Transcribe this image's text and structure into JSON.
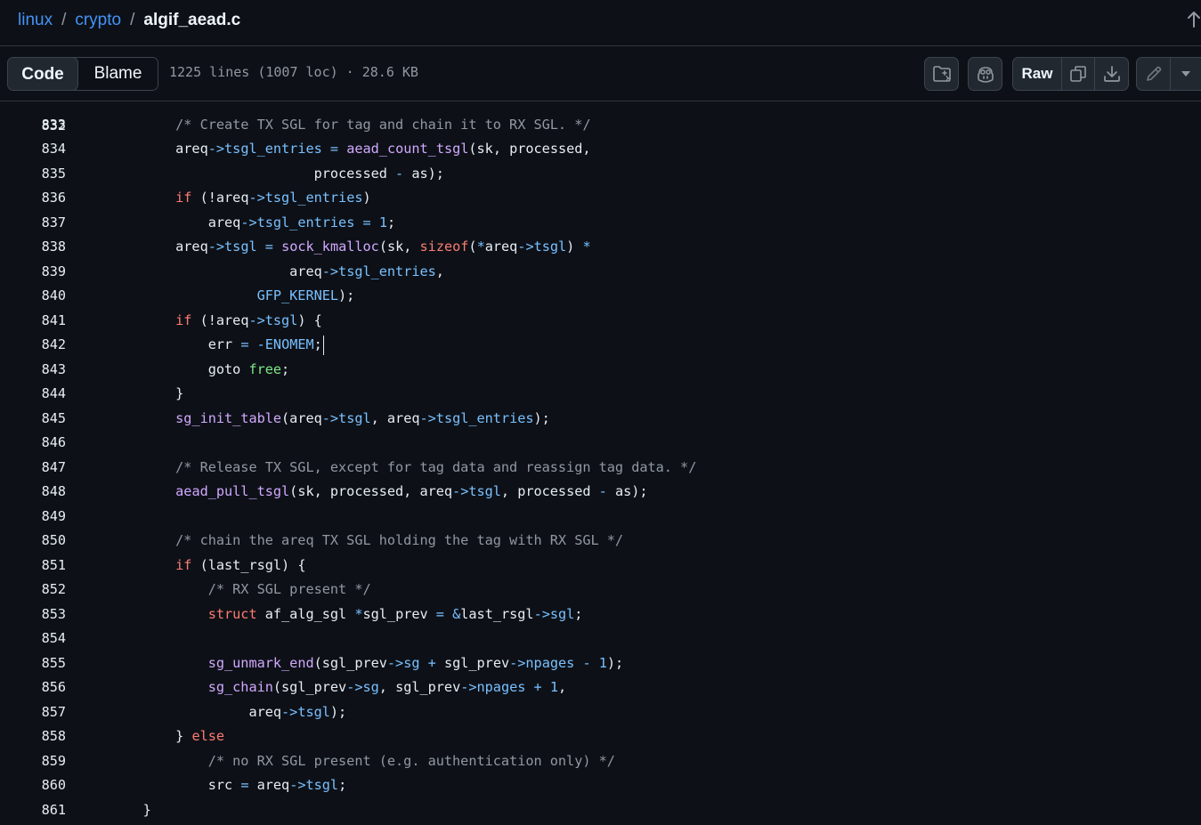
{
  "breadcrumb": {
    "repo": "linux",
    "folder": "crypto",
    "file": "algif_aead.c",
    "separator": "/"
  },
  "toolbar": {
    "code_tab": "Code",
    "blame_tab": "Blame",
    "file_info": "1225 lines (1007 loc) · 28.6 KB",
    "raw_label": "Raw"
  },
  "icons": {
    "scroll_top": "arrow-up-icon",
    "symbols": "file-directory-symlink-icon",
    "copilot": "copilot-icon",
    "copy": "copy-icon",
    "download": "download-icon",
    "edit": "pencil-icon",
    "more": "triangle-down-icon"
  },
  "colors": {
    "background": "#0d1117",
    "text": "#e6edf3",
    "link": "#4493f8",
    "comment": "#9198a1",
    "function": "#d2a8ff",
    "keyword": "#ff7b72",
    "property": "#79c0ff",
    "label": "#7ee787"
  },
  "code": {
    "partial_top_line": "832",
    "lines": [
      {
        "n": "833",
        "tokens": [
          [
            "        ",
            ""
          ],
          [
            "/* Create TX SGL for tag and chain it to RX SGL. */",
            "c"
          ]
        ]
      },
      {
        "n": "834",
        "tokens": [
          [
            "        areq",
            ""
          ],
          [
            "->",
            "o"
          ],
          [
            "tsgl_entries",
            "p"
          ],
          [
            " ",
            ""
          ],
          [
            "=",
            "o"
          ],
          [
            " ",
            ""
          ],
          [
            "aead_count_tsgl",
            "f"
          ],
          [
            "(sk, processed,",
            ""
          ]
        ]
      },
      {
        "n": "835",
        "tokens": [
          [
            "                         processed ",
            ""
          ],
          [
            "-",
            "o"
          ],
          [
            " as);",
            ""
          ]
        ]
      },
      {
        "n": "836",
        "tokens": [
          [
            "        ",
            ""
          ],
          [
            "if",
            "k"
          ],
          [
            " (!areq",
            ""
          ],
          [
            "->",
            "o"
          ],
          [
            "tsgl_entries",
            "p"
          ],
          [
            ")",
            ""
          ]
        ]
      },
      {
        "n": "837",
        "tokens": [
          [
            "            areq",
            ""
          ],
          [
            "->",
            "o"
          ],
          [
            "tsgl_entries",
            "p"
          ],
          [
            " ",
            ""
          ],
          [
            "=",
            "o"
          ],
          [
            " ",
            ""
          ],
          [
            "1",
            "p"
          ],
          [
            ";",
            ""
          ]
        ]
      },
      {
        "n": "838",
        "tokens": [
          [
            "        areq",
            ""
          ],
          [
            "->",
            "o"
          ],
          [
            "tsgl",
            "p"
          ],
          [
            " ",
            ""
          ],
          [
            "=",
            "o"
          ],
          [
            " ",
            ""
          ],
          [
            "sock_kmalloc",
            "f"
          ],
          [
            "(sk, ",
            ""
          ],
          [
            "sizeof",
            "k"
          ],
          [
            "(",
            ""
          ],
          [
            "*",
            "o"
          ],
          [
            "areq",
            ""
          ],
          [
            "->",
            "o"
          ],
          [
            "tsgl",
            "p"
          ],
          [
            ") ",
            ""
          ],
          [
            "*",
            "o"
          ]
        ]
      },
      {
        "n": "839",
        "tokens": [
          [
            "                      areq",
            ""
          ],
          [
            "->",
            "o"
          ],
          [
            "tsgl_entries",
            "p"
          ],
          [
            ",",
            ""
          ]
        ]
      },
      {
        "n": "840",
        "tokens": [
          [
            "                  ",
            ""
          ],
          [
            "GFP_KERNEL",
            "p"
          ],
          [
            ");",
            ""
          ]
        ]
      },
      {
        "n": "841",
        "tokens": [
          [
            "        ",
            ""
          ],
          [
            "if",
            "k"
          ],
          [
            " (!areq",
            ""
          ],
          [
            "->",
            "o"
          ],
          [
            "tsgl",
            "p"
          ],
          [
            ") {",
            ""
          ]
        ]
      },
      {
        "n": "842",
        "tokens": [
          [
            "            err ",
            ""
          ],
          [
            "=",
            "o"
          ],
          [
            " ",
            ""
          ],
          [
            "-",
            "o"
          ],
          [
            "ENOMEM",
            "p"
          ],
          [
            ";",
            ""
          ]
        ],
        "cursor": true
      },
      {
        "n": "843",
        "tokens": [
          [
            "            goto ",
            ""
          ],
          [
            "free",
            "l"
          ],
          [
            ";",
            ""
          ]
        ]
      },
      {
        "n": "844",
        "tokens": [
          [
            "        }",
            ""
          ]
        ]
      },
      {
        "n": "845",
        "tokens": [
          [
            "        ",
            ""
          ],
          [
            "sg_init_table",
            "f"
          ],
          [
            "(areq",
            ""
          ],
          [
            "->",
            "o"
          ],
          [
            "tsgl",
            "p"
          ],
          [
            ", areq",
            ""
          ],
          [
            "->",
            "o"
          ],
          [
            "tsgl_entries",
            "p"
          ],
          [
            ");",
            ""
          ]
        ]
      },
      {
        "n": "846",
        "tokens": [
          [
            "",
            ""
          ]
        ]
      },
      {
        "n": "847",
        "tokens": [
          [
            "        ",
            ""
          ],
          [
            "/* Release TX SGL, except for tag data and reassign tag data. */",
            "c"
          ]
        ]
      },
      {
        "n": "848",
        "tokens": [
          [
            "        ",
            ""
          ],
          [
            "aead_pull_tsgl",
            "f"
          ],
          [
            "(sk, processed, areq",
            ""
          ],
          [
            "->",
            "o"
          ],
          [
            "tsgl",
            "p"
          ],
          [
            ", processed ",
            ""
          ],
          [
            "-",
            "o"
          ],
          [
            " as);",
            ""
          ]
        ]
      },
      {
        "n": "849",
        "tokens": [
          [
            "",
            ""
          ]
        ]
      },
      {
        "n": "850",
        "tokens": [
          [
            "        ",
            ""
          ],
          [
            "/* chain the areq TX SGL holding the tag with RX SGL */",
            "c"
          ]
        ]
      },
      {
        "n": "851",
        "tokens": [
          [
            "        ",
            ""
          ],
          [
            "if",
            "k"
          ],
          [
            " (last_rsgl) {",
            ""
          ]
        ]
      },
      {
        "n": "852",
        "tokens": [
          [
            "            ",
            ""
          ],
          [
            "/* RX SGL present */",
            "c"
          ]
        ]
      },
      {
        "n": "853",
        "tokens": [
          [
            "            ",
            ""
          ],
          [
            "struct",
            "k"
          ],
          [
            " af_alg_sgl ",
            ""
          ],
          [
            "*",
            "o"
          ],
          [
            "sgl_prev ",
            ""
          ],
          [
            "=",
            "o"
          ],
          [
            " ",
            ""
          ],
          [
            "&",
            "o"
          ],
          [
            "last_rsgl",
            ""
          ],
          [
            "->",
            "o"
          ],
          [
            "sgl",
            "p"
          ],
          [
            ";",
            ""
          ]
        ]
      },
      {
        "n": "854",
        "tokens": [
          [
            "",
            ""
          ]
        ]
      },
      {
        "n": "855",
        "tokens": [
          [
            "            ",
            ""
          ],
          [
            "sg_unmark_end",
            "f"
          ],
          [
            "(sgl_prev",
            ""
          ],
          [
            "->",
            "o"
          ],
          [
            "sg",
            "p"
          ],
          [
            " ",
            ""
          ],
          [
            "+",
            "o"
          ],
          [
            " sgl_prev",
            ""
          ],
          [
            "->",
            "o"
          ],
          [
            "npages",
            "p"
          ],
          [
            " ",
            ""
          ],
          [
            "-",
            "o"
          ],
          [
            " ",
            ""
          ],
          [
            "1",
            "p"
          ],
          [
            ");",
            ""
          ]
        ]
      },
      {
        "n": "856",
        "tokens": [
          [
            "            ",
            ""
          ],
          [
            "sg_chain",
            "f"
          ],
          [
            "(sgl_prev",
            ""
          ],
          [
            "->",
            "o"
          ],
          [
            "sg",
            "p"
          ],
          [
            ", sgl_prev",
            ""
          ],
          [
            "->",
            "o"
          ],
          [
            "npages",
            "p"
          ],
          [
            " ",
            ""
          ],
          [
            "+",
            "o"
          ],
          [
            " ",
            ""
          ],
          [
            "1",
            "p"
          ],
          [
            ",",
            ""
          ]
        ]
      },
      {
        "n": "857",
        "tokens": [
          [
            "                 areq",
            ""
          ],
          [
            "->",
            "o"
          ],
          [
            "tsgl",
            "p"
          ],
          [
            ");",
            ""
          ]
        ]
      },
      {
        "n": "858",
        "tokens": [
          [
            "        } ",
            ""
          ],
          [
            "else",
            "k"
          ]
        ]
      },
      {
        "n": "859",
        "tokens": [
          [
            "            ",
            ""
          ],
          [
            "/* no RX SGL present (e.g. authentication only) */",
            "c"
          ]
        ]
      },
      {
        "n": "860",
        "tokens": [
          [
            "            src ",
            ""
          ],
          [
            "=",
            "o"
          ],
          [
            " areq",
            ""
          ],
          [
            "->",
            "o"
          ],
          [
            "tsgl",
            "p"
          ],
          [
            ";",
            ""
          ]
        ]
      },
      {
        "n": "861",
        "tokens": [
          [
            "    }",
            ""
          ]
        ]
      }
    ]
  }
}
